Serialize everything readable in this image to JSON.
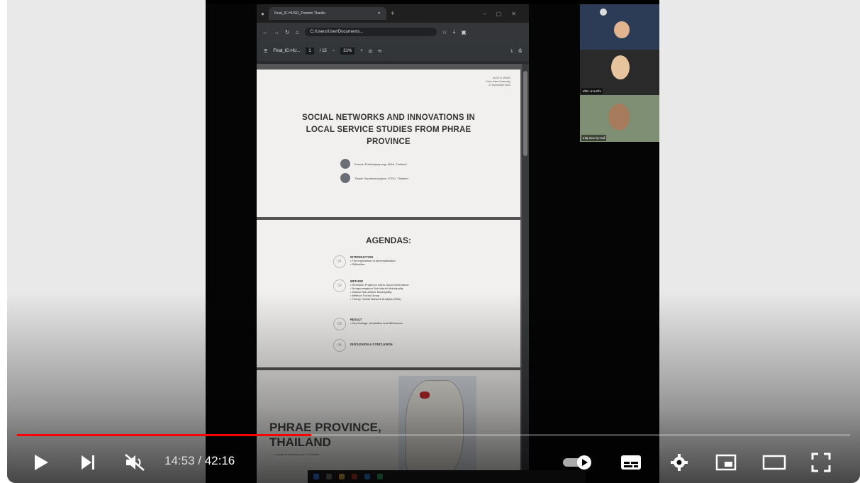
{
  "player": {
    "current_time": "14:53",
    "separator": " / ",
    "duration": "42:16",
    "progress_fraction": 0.353
  },
  "browser": {
    "tab_title": "Final_IC-HUSO_Poomin Thaollo",
    "url": "C:/Users/User/Documents...",
    "file_label": "Final_IC-HU...",
    "page_current": "1",
    "page_total": "/ 15",
    "zoom": "31%"
  },
  "slide1": {
    "meta": "18-19 IC-HUSO\nKhon Kaen University\n27 November 2023",
    "title": "SOCIAL NETWORKS AND INNOVATIONS IN LOCAL SERVICE STUDIES FROM PHRAE PROVINCE",
    "author1": "Poomin Pothisiriyanpong, NIDA, Thailand",
    "author2": "Thaolo Supatanarungsan, STOU, Thailand"
  },
  "slide2": {
    "title": "AGENDAS:",
    "items": [
      {
        "num": "01",
        "head": "INTRODUCTION",
        "lines": "• The importance of decentralization\n• Difficulties"
      },
      {
        "num": "02",
        "head": "METHOD",
        "lines": "• Research Project of LAOs Good Governance\n• Nongmuangkhai Sub-district Municipality\n• Maesai Sub-district Municipality\n• Method: Focus Group\n• Theory: Social Network Analysis (SNA)"
      },
      {
        "num": "03",
        "head": "RESULT",
        "lines": "• Key findings: similarities and differences"
      },
      {
        "num": "04",
        "head": "DISCUSSION & CONCLUSION",
        "lines": ""
      }
    ]
  },
  "slide3": {
    "title": "PHRAE PROVINCE, THAILAND",
    "subtitle": "• Locate in Northern part of Thailand"
  },
  "participants": {
    "cam2_label": "ศรีดา ทรงเสริม",
    "cam3_label": "ธนัฐ สมนาสุวรรณ์"
  },
  "colors": {
    "progress": "#ff0000",
    "icons": "#ffffff"
  }
}
